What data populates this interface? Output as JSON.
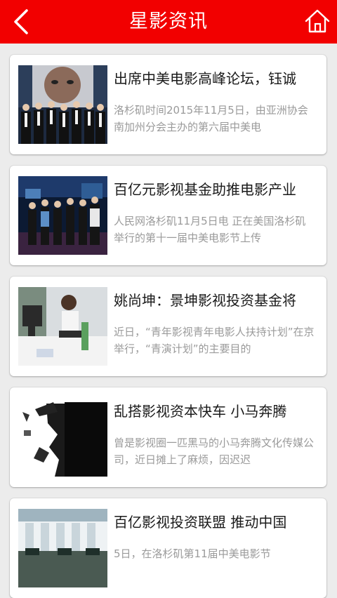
{
  "header": {
    "title": "星影资讯",
    "back_icon": "chevron-left-icon",
    "home_icon": "home-icon",
    "bg_color": "#f20000"
  },
  "news": [
    {
      "title": "出席中美电影高峰论坛，钰诚",
      "summary": "洛杉矶时间2015年11月5日，由亚洲协会南加州分会主办的第六届中美电"
    },
    {
      "title": "百亿元影视基金助推电影产业",
      "summary": "人民网洛杉矶11月5日电 正在美国洛杉矶举行的第十一届中美电影节上传"
    },
    {
      "title": "姚尚坤：景坤影视投资基金将",
      "summary": "近日，“青年影视青年电影人扶持计划”在京举行，“青演计划”的主要目的"
    },
    {
      "title": "乱搭影视资本快车 小马奔腾",
      "summary": "曾是影视圈一匹黑马的小马奔腾文化传媒公司，近日摊上了麻烦，因迟迟"
    },
    {
      "title": "百亿影视投资联盟 推动中国",
      "summary": "5日，在洛杉矶第11届中美电影节"
    }
  ]
}
